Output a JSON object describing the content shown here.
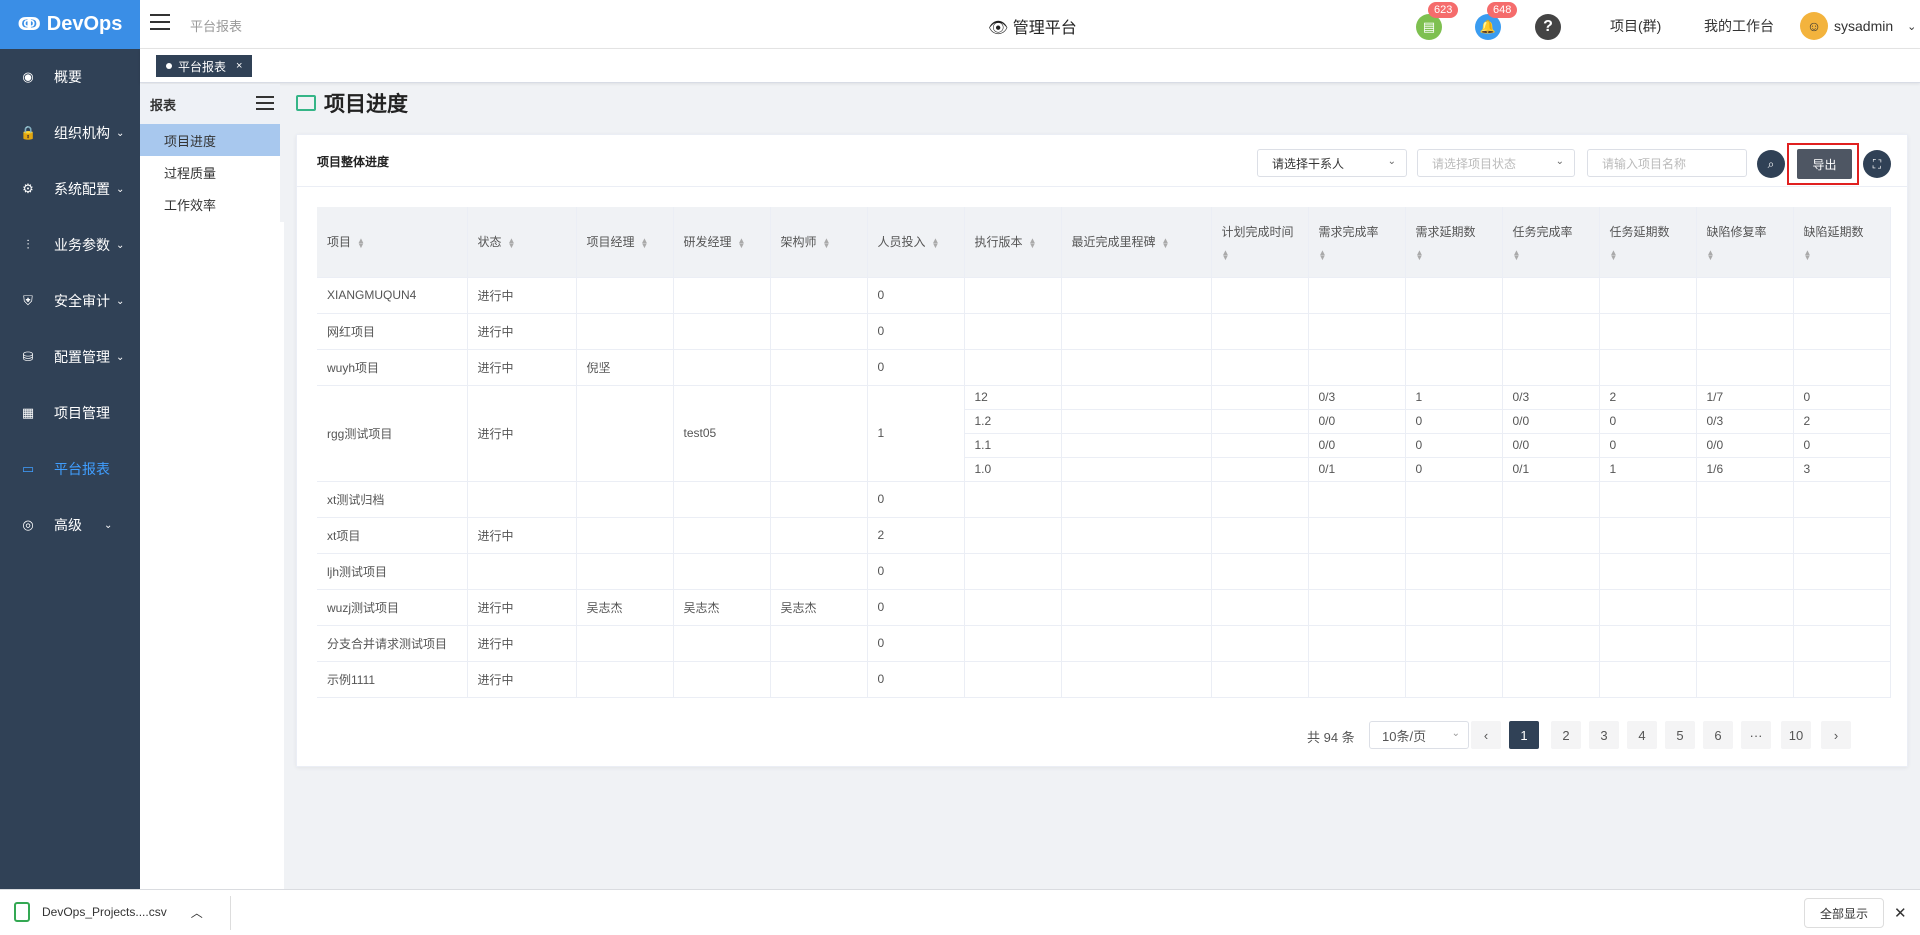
{
  "header": {
    "logo": "DevOps",
    "breadcrumb": "平台报表",
    "center_title": "管理平台",
    "doc_badge": "623",
    "bell_badge": "648",
    "help": "?",
    "link_projects": "项目(群)",
    "link_workbench": "我的工作台",
    "username": "sysadmin"
  },
  "sidebar": {
    "items": [
      {
        "label": "概要",
        "icon": "dashboard-icon"
      },
      {
        "label": "组织机构",
        "icon": "lock-icon"
      },
      {
        "label": "系统配置",
        "icon": "gear-icon"
      },
      {
        "label": "业务参数",
        "icon": "sliders-icon"
      },
      {
        "label": "安全审计",
        "icon": "shield-icon"
      },
      {
        "label": "配置管理",
        "icon": "database-icon"
      },
      {
        "label": "项目管理",
        "icon": "grid-icon"
      },
      {
        "label": "平台报表",
        "icon": "monitor-icon"
      },
      {
        "label": "高级",
        "icon": "palette-icon"
      }
    ]
  },
  "tabs": {
    "active": "平台报表",
    "close": "×"
  },
  "submenu": {
    "title": "报表",
    "items": [
      "项目进度",
      "过程质量",
      "工作效率"
    ]
  },
  "page": {
    "title": "项目进度"
  },
  "card": {
    "title": "项目整体进度",
    "filter_person_placeholder": "请选择干系人",
    "filter_status_placeholder": "请选择项目状态",
    "filter_name_placeholder": "请输入项目名称",
    "export_label": "导出"
  },
  "table": {
    "columns": [
      "项目",
      "状态",
      "项目经理",
      "研发经理",
      "架构师",
      "人员投入",
      "执行版本",
      "最近完成里程碑",
      "计划完成时间",
      "需求完成率",
      "需求延期数",
      "任务完成率",
      "任务延期数",
      "缺陷修复率",
      "缺陷延期数"
    ],
    "rows": [
      {
        "project": "XIANGMUQUN4",
        "status": "进行中",
        "pm": "",
        "rd": "",
        "arch": "",
        "staff": "0"
      },
      {
        "project": "网红项目",
        "status": "进行中",
        "pm": "",
        "rd": "",
        "arch": "",
        "staff": "0"
      },
      {
        "project": "wuyh项目",
        "status": "进行中",
        "pm": "倪坚",
        "rd": "",
        "arch": "",
        "staff": "0"
      },
      {
        "project": "rgg测试项目",
        "status": "进行中",
        "pm": "",
        "rd": "test05",
        "arch": "",
        "staff": "1",
        "versions": [
          {
            "ver": "12",
            "req_rate": "0/3",
            "req_delay": "1",
            "task_rate": "0/3",
            "task_delay": "2",
            "bug_rate": "1/7",
            "bug_delay": "0"
          },
          {
            "ver": "1.2",
            "req_rate": "0/0",
            "req_delay": "0",
            "task_rate": "0/0",
            "task_delay": "0",
            "bug_rate": "0/3",
            "bug_delay": "2"
          },
          {
            "ver": "1.1",
            "req_rate": "0/0",
            "req_delay": "0",
            "task_rate": "0/0",
            "task_delay": "0",
            "bug_rate": "0/0",
            "bug_delay": "0"
          },
          {
            "ver": "1.0",
            "req_rate": "0/1",
            "req_delay": "0",
            "task_rate": "0/1",
            "task_delay": "1",
            "bug_rate": "1/6",
            "bug_delay": "3"
          }
        ]
      },
      {
        "project": "xt测试归档",
        "status": "",
        "pm": "",
        "rd": "",
        "arch": "",
        "staff": "0"
      },
      {
        "project": "xt项目",
        "status": "进行中",
        "pm": "",
        "rd": "",
        "arch": "",
        "staff": "2"
      },
      {
        "project": "ljh测试项目",
        "status": "",
        "pm": "",
        "rd": "",
        "arch": "",
        "staff": "0"
      },
      {
        "project": "wuzj测试项目",
        "status": "进行中",
        "pm": "吴志杰",
        "rd": "吴志杰",
        "arch": "吴志杰",
        "staff": "0"
      },
      {
        "project": "分支合并请求测试项目",
        "status": "进行中",
        "pm": "",
        "rd": "",
        "arch": "",
        "staff": "0"
      },
      {
        "project": "示例1111",
        "status": "进行中",
        "pm": "",
        "rd": "",
        "arch": "",
        "staff": "0"
      }
    ]
  },
  "pagination": {
    "total": "共 94 条",
    "page_size": "10条/页",
    "prev": "‹",
    "next": "›",
    "pages": [
      "1",
      "2",
      "3",
      "4",
      "5",
      "6",
      "···",
      "10"
    ],
    "current": "1"
  },
  "download_bar": {
    "file": "DevOps_Projects....csv",
    "show_all": "全部显示",
    "close": "✕"
  }
}
